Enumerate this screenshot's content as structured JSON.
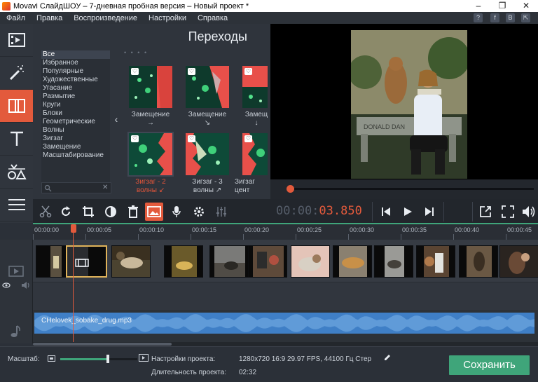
{
  "window": {
    "title": "Movavi СлайдШОУ – 7-дневная пробная версия – Новый проект *",
    "minimize": "–",
    "maximize": "❐",
    "close": "✕"
  },
  "menu": [
    "Файл",
    "Правка",
    "Воспроизведение",
    "Настройки",
    "Справка"
  ],
  "tray_icons": [
    "?",
    "f",
    "B",
    "⇱"
  ],
  "tools": [
    {
      "name": "files-tool",
      "icon": "filmstrip-icon"
    },
    {
      "name": "filters-tool",
      "icon": "magic-wand-icon"
    },
    {
      "name": "transitions-tool",
      "icon": "transitions-icon",
      "active": true
    },
    {
      "name": "titles-tool",
      "icon": "text-icon"
    },
    {
      "name": "shapes-tool",
      "icon": "shapes-icon"
    },
    {
      "name": "more-tool",
      "icon": "menu-lines-icon"
    }
  ],
  "panel": {
    "title": "Переходы",
    "categories": [
      "Все",
      "Избранное",
      "Популярные",
      "Художественные",
      "Угасание",
      "Размытие",
      "Круги",
      "Блоки",
      "Геометрические",
      "Волны",
      "Зигзаг",
      "Замещение",
      "Масштабирование"
    ],
    "selected_category": "Все",
    "search_clear": "✕",
    "collapse": "‹",
    "scroll_dots": "• •     • •"
  },
  "transitions": [
    {
      "label1": "Замещение",
      "label2": "→",
      "selected": false
    },
    {
      "label1": "Замещение",
      "label2": "↘",
      "selected": false
    },
    {
      "label1": "Замещ",
      "label2": "↓",
      "selected": false
    },
    {
      "label1": "Зигзаг - 2",
      "label2": "волны ↙",
      "selected": true
    },
    {
      "label1": "Зигзаг - 3",
      "label2": "волны ↗",
      "selected": false
    },
    {
      "label1": "Зигзаг",
      "label2": "цент",
      "selected": false
    }
  ],
  "player": {
    "timecode_dim": "00:00:",
    "timecode_hi": "03.850",
    "progress": 0.01
  },
  "timeline": {
    "ruler_labels": [
      "00:00:00",
      "00:00:05",
      "00:00:10",
      "00:00:15",
      "00:00:20",
      "00:00:25",
      "00:00:30",
      "00:00:35",
      "00:00:40",
      "00:00:45"
    ],
    "audio_clip": "CHelovek_sobake_drug.mp3"
  },
  "bottom": {
    "zoom_label": "Масштаб:",
    "project_settings_label": "Настройки проекта:",
    "project_settings_value": "1280x720 16:9 29.97 FPS, 44100 Гц Стер",
    "duration_label": "Длительность проекта:",
    "duration_value": "02:32",
    "zoom_level": 0.62,
    "save": "Сохранить"
  },
  "colors": {
    "accent": "#e35a3c",
    "green": "#3fa57a",
    "audio": "#3f7fc6"
  }
}
